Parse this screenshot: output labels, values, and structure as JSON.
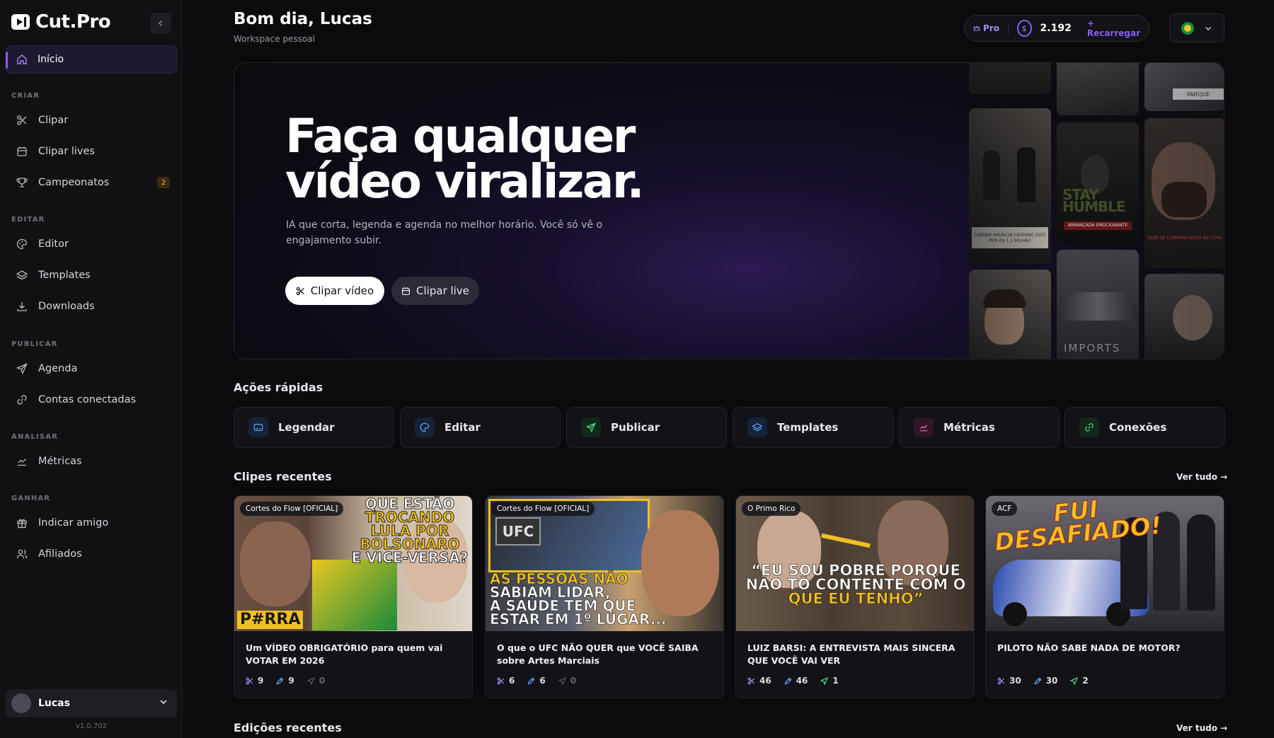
{
  "app": {
    "name": "Cut.Pro",
    "version": "v1.0.702"
  },
  "header": {
    "greeting": "Bom dia, Lucas",
    "workspace": "Workspace pessoal",
    "plan": "Pro",
    "credits": "2.192",
    "recharge": "+ Recarregar"
  },
  "sidebar": {
    "home": "Início",
    "sections": [
      {
        "title": "CRIAR",
        "items": [
          {
            "label": "Clipar",
            "icon": "scissors-icon"
          },
          {
            "label": "Clipar lives",
            "icon": "calendar-icon"
          },
          {
            "label": "Campeonatos",
            "icon": "trophy-icon",
            "badge": "2"
          }
        ]
      },
      {
        "title": "EDITAR",
        "items": [
          {
            "label": "Editor",
            "icon": "palette-icon"
          },
          {
            "label": "Templates",
            "icon": "layers-icon"
          },
          {
            "label": "Downloads",
            "icon": "download-icon"
          }
        ]
      },
      {
        "title": "PUBLICAR",
        "items": [
          {
            "label": "Agenda",
            "icon": "send-icon"
          },
          {
            "label": "Contas conectadas",
            "icon": "link-icon"
          }
        ]
      },
      {
        "title": "ANALISAR",
        "items": [
          {
            "label": "Métricas",
            "icon": "chart-icon"
          }
        ]
      },
      {
        "title": "GANHAR",
        "items": [
          {
            "label": "Indicar amigo",
            "icon": "gift-icon"
          },
          {
            "label": "Afiliados",
            "icon": "users-icon"
          }
        ]
      }
    ],
    "user": "Lucas"
  },
  "hero": {
    "title": "Faça qualquer\nvídeo viralizar.",
    "subtitle": "IA que corta, legenda e agenda no melhor horário. Você só vê o engajamento subir.",
    "primary_cta": "Clipar vídeo",
    "secondary_cta": "Clipar live",
    "tile_captions": [
      "CARIANI ANUNCIA CAYENNE 2025 POR R$ 1,1 MILHÃO",
      "ARRANCADA EMOCIONANTE",
      "IGOR SE COMPARA NESSI NA COPA",
      "PARQUE",
      "STAY HUMBLE",
      "IMPORTS"
    ]
  },
  "quick_actions": {
    "title": "Ações rápidas",
    "items": [
      {
        "label": "Legendar",
        "icon": "caption-icon",
        "color": "#60a5fa"
      },
      {
        "label": "Editar",
        "icon": "palette-icon",
        "color": "#60a5fa"
      },
      {
        "label": "Publicar",
        "icon": "send-icon",
        "color": "#4ade80"
      },
      {
        "label": "Templates",
        "icon": "layers-icon",
        "color": "#60a5fa"
      },
      {
        "label": "Métricas",
        "icon": "chart-icon",
        "color": "#f472b6"
      },
      {
        "label": "Conexões",
        "icon": "link-icon",
        "color": "#4ade80"
      }
    ]
  },
  "recent_clips": {
    "title": "Clipes recentes",
    "see_all": "Ver tudo →",
    "items": [
      {
        "channel": "Cortes do Flow [OFICIAL]",
        "title": "Um VÍDEO OBRIGATÓRIO para quem vai VOTAR EM 2026",
        "clips": "9",
        "edits": "9",
        "posts": "0",
        "overlay": [
          "QUE ESTÃO",
          "TROCANDO",
          "LULA POR",
          "BOLSONARO",
          "E VICE-VERSA?"
        ],
        "tag": "P#RRA"
      },
      {
        "channel": "Cortes do Flow [OFICIAL]",
        "title": "O que o UFC NÃO QUER que VOCÊ SAIBA sobre Artes Marciais",
        "clips": "6",
        "edits": "6",
        "posts": "0",
        "overlay": [
          "AS PESSOAS NÃO",
          "SABIAM LIDAR,",
          "A SAÚDE TEM QUE",
          "ESTAR EM 1º LUGAR..."
        ],
        "tag": "UFC"
      },
      {
        "channel": "O Primo Rico",
        "title": "LUIZ BARSI: A ENTREVISTA MAIS SINCERA QUE VOCÊ VAI VER",
        "clips": "46",
        "edits": "46",
        "posts": "1",
        "overlay": [
          "“EU SOU POBRE PORQUE",
          "NÃO TÔ CONTENTE COM O",
          "QUE EU TENHO”"
        ]
      },
      {
        "channel": "ACF",
        "title": "PILOTO NÃO SABE NADA DE MOTOR?",
        "clips": "30",
        "edits": "30",
        "posts": "2",
        "overlay": [
          "FUI",
          "DESAFIADO!"
        ]
      }
    ]
  },
  "recent_edits": {
    "title": "Edições recentes",
    "see_all": "Ver tudo →"
  }
}
